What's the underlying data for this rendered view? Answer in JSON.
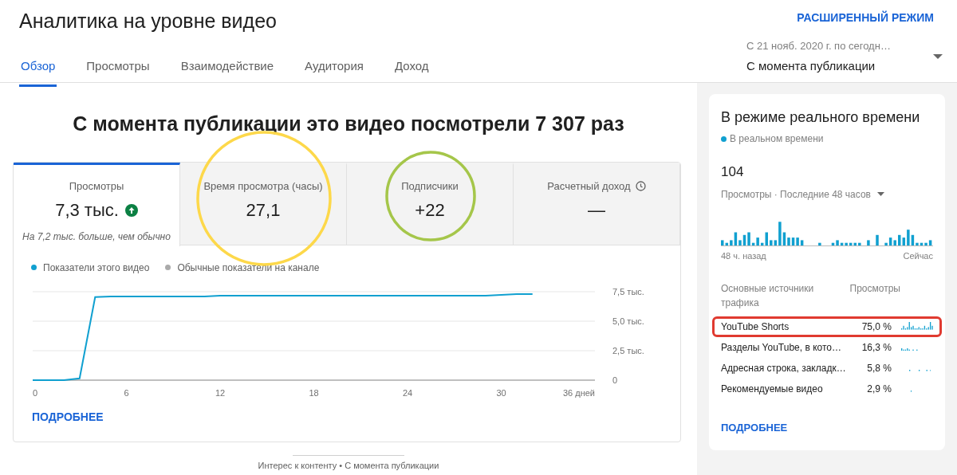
{
  "header": {
    "title": "Аналитика на уровне видео",
    "advanced_link": "РАСШИРЕННЫЙ РЕЖИМ"
  },
  "tabs": [
    {
      "label": "Обзор",
      "selected": true
    },
    {
      "label": "Просмотры",
      "selected": false
    },
    {
      "label": "Взаимодействие",
      "selected": false
    },
    {
      "label": "Аудитория",
      "selected": false
    },
    {
      "label": "Доход",
      "selected": false
    }
  ],
  "period": {
    "range": "С 21 нояб. 2020 г. по сегодн…",
    "label": "С момента публикации"
  },
  "headline": "С момента публикации это видео посмотрели 7 307 раз",
  "metrics": [
    {
      "label": "Просмотры",
      "value": "7,3 тыс.",
      "selected": true,
      "trend_up": true,
      "note": "На 7,2 тыс. больше, чем обычно"
    },
    {
      "label": "Время просмотра (часы)",
      "value": "27,1",
      "selected": false,
      "circle": {
        "color": "#fdd84a"
      }
    },
    {
      "label": "Подписчики",
      "value": "+22",
      "selected": false,
      "circle": {
        "color": "#a5c64a"
      }
    },
    {
      "label": "Расчетный доход",
      "value": "—",
      "selected": false,
      "info_icon": true
    }
  ],
  "baseline_legend": {
    "label": "Обычные показатели на канале",
    "color": "#aaaaaa"
  },
  "chart_data": {
    "type": "line",
    "x": [
      0,
      1,
      2,
      3,
      4,
      5,
      6,
      7,
      8,
      9,
      10,
      11,
      12,
      13,
      14,
      15,
      16,
      17,
      18,
      19,
      20,
      21,
      22,
      23,
      24,
      25,
      26,
      27,
      28,
      29,
      30,
      31,
      32
    ],
    "series": [
      {
        "name": "Показатели этого видео",
        "color": "#10a0d0",
        "values": [
          0,
          0,
          0,
          0.15,
          7.05,
          7.1,
          7.1,
          7.1,
          7.1,
          7.1,
          7.1,
          7.1,
          7.17,
          7.17,
          7.17,
          7.17,
          7.17,
          7.17,
          7.17,
          7.17,
          7.17,
          7.17,
          7.17,
          7.17,
          7.17,
          7.17,
          7.17,
          7.17,
          7.17,
          7.17,
          7.22,
          7.3,
          7.3
        ]
      }
    ],
    "xlim": [
      0,
      36
    ],
    "ylim": [
      0,
      7.5
    ],
    "xticks": [
      0,
      6,
      12,
      18,
      24,
      30,
      {
        "value": 36,
        "label": "36 дней"
      }
    ],
    "yticks": [
      {
        "value": 0,
        "label": "0"
      },
      {
        "value": 2.5,
        "label": "2,5 тыс."
      },
      {
        "value": 5,
        "label": "5,0 тыс."
      },
      {
        "value": 7.5,
        "label": "7,5 тыс."
      }
    ]
  },
  "more_link": "ПОДРОБНЕЕ",
  "bottom_caption": "Интерес к контенту • С момента публикации",
  "realtime": {
    "title": "В режиме реального времени",
    "status": {
      "label": "В реальном времени",
      "color": "#10a0d0"
    },
    "count": "104",
    "count_label": "Просмотры · Последние 48 часов",
    "axis_start": "48 ч. назад",
    "axis_end": "Сейчас",
    "sources_header": "Основные источники трафика",
    "views_header": "Просмотры",
    "sources": [
      {
        "name": "YouTube Shorts",
        "share": "75,0 %",
        "highlighted": true
      },
      {
        "name": "Разделы YouTube, в кото…",
        "share": "16,3 %",
        "highlighted": false
      },
      {
        "name": "Адресная строка, закладк…",
        "share": "5,8 %",
        "highlighted": false
      },
      {
        "name": "Рекомендуемые видео",
        "share": "2,9 %",
        "highlighted": false
      }
    ],
    "more_link": "ПОДРОБНЕЕ"
  }
}
